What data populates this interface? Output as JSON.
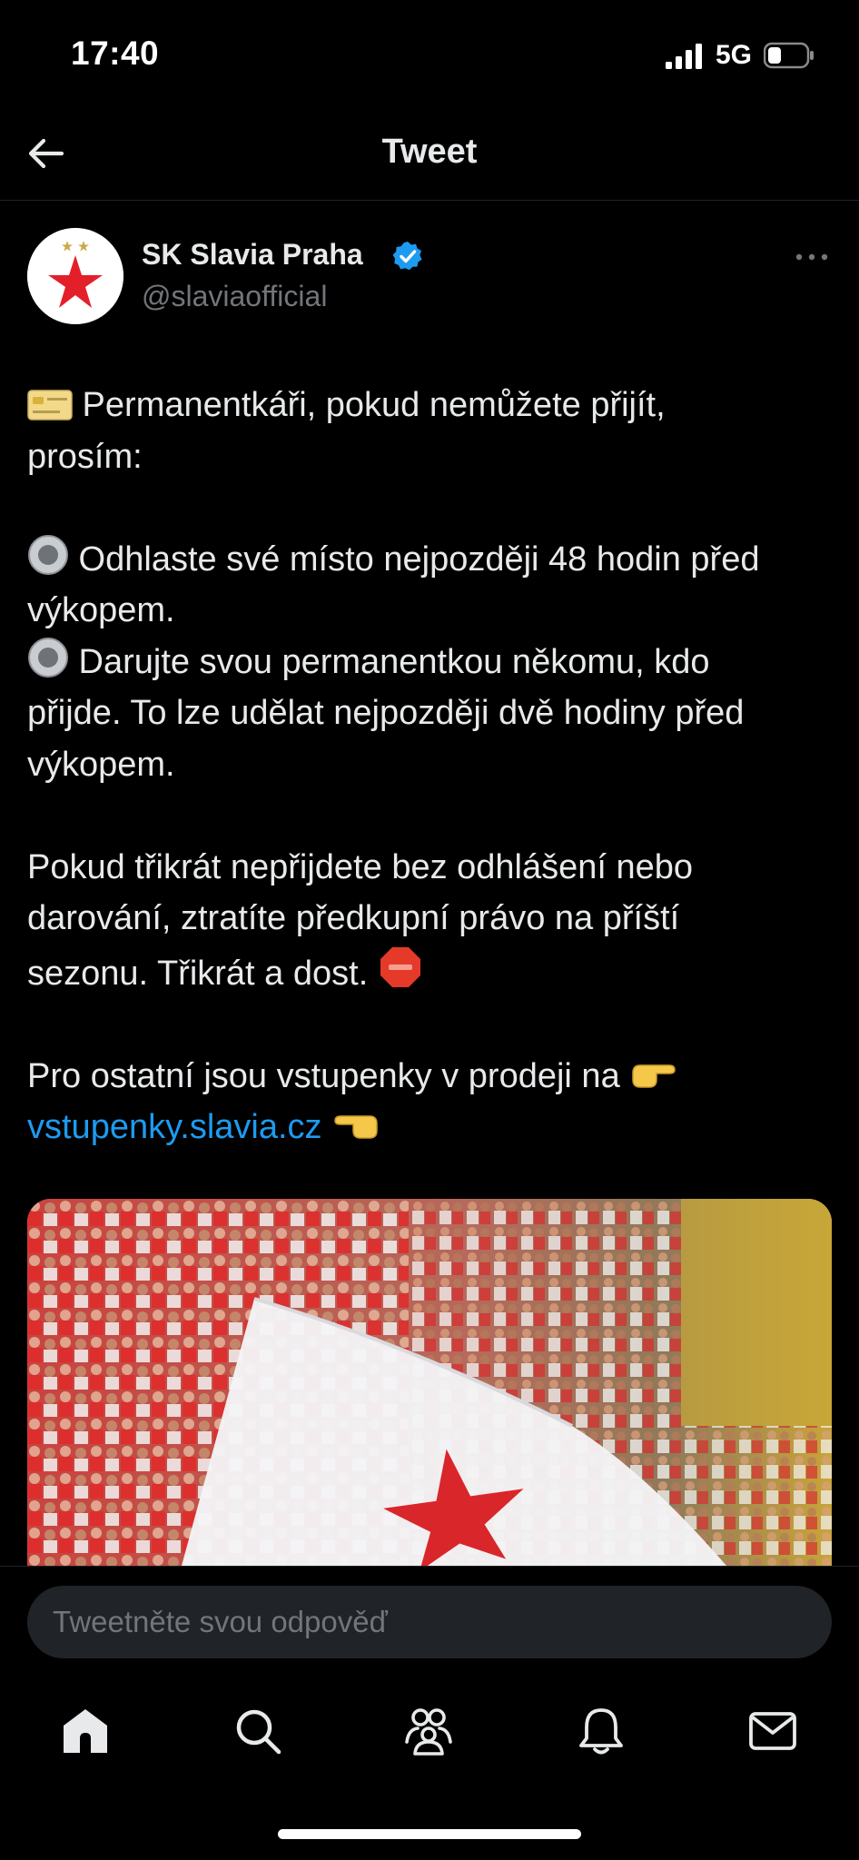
{
  "status_bar": {
    "time": "17:40",
    "network": "5G"
  },
  "header": {
    "title": "Tweet",
    "back_icon": "arrow-left-icon"
  },
  "tweet": {
    "author_name": "SK Slavia Praha",
    "author_handle": "@slaviaofficial",
    "verified": true,
    "lines": {
      "l1": " Permanentkáři, pokud nemůžete přijít,",
      "l2": "prosím:",
      "l3": " Odhlaste své místo nejpozději 48 hodin před",
      "l4": "výkopem.",
      "l5": " Darujte svou permanentkou někomu, kdo",
      "l6": "přijde. To lze udělat nejpozději dvě hodiny před",
      "l7": "výkopem.",
      "l8": "Pokud třikrát nepřijdete bez odhlášení nebo",
      "l9": "darování, ztratíte předkupní právo na příští",
      "l10": "sezonu. Třikrát a dost. ",
      "l11": "Pro ostatní jsou vstupenky v prodeji na ",
      "link": "vstupenky.slavia.cz"
    }
  },
  "reply": {
    "placeholder": "Tweetněte svou odpověď"
  },
  "tabbar": {
    "items": [
      "home-icon",
      "search-icon",
      "communities-icon",
      "notifications-icon",
      "messages-icon"
    ]
  },
  "colors": {
    "background": "#000000",
    "link": "#1d9bf0",
    "verified": "#1d9bf0",
    "secondary": "#71767b"
  }
}
